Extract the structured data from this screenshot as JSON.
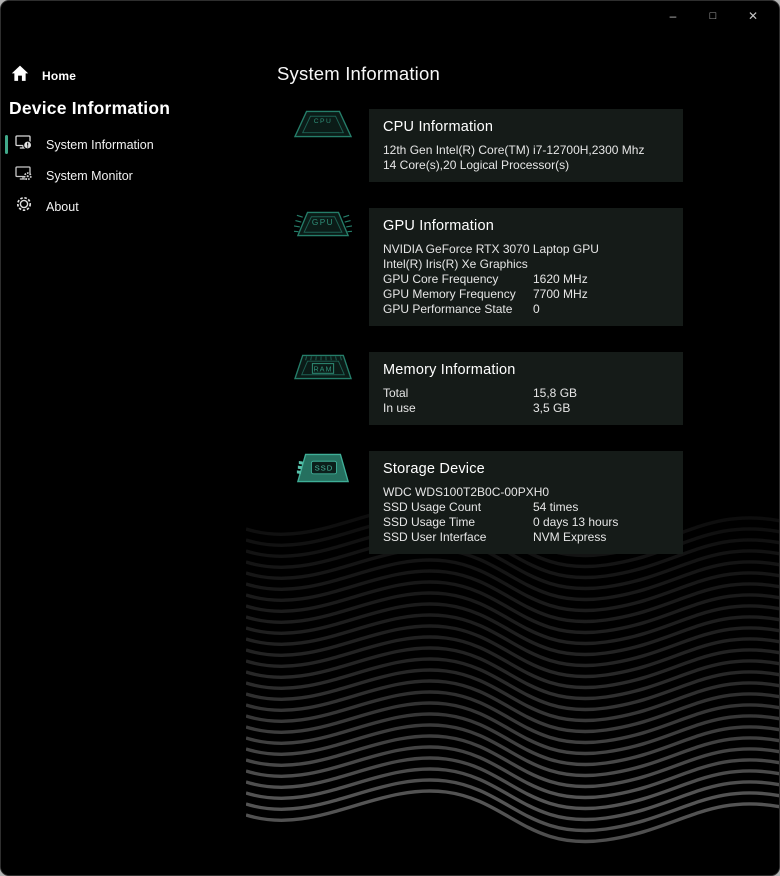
{
  "colors": {
    "accent": "#41a98a",
    "chip_teal": "#2a8770",
    "card_bg": "#151b18"
  },
  "window": {
    "controls": {
      "minimize": "–",
      "maximize": "□",
      "close": "✕"
    }
  },
  "sidebar": {
    "home_label": "Home",
    "heading": "Device Information",
    "items": [
      {
        "label": "System Information",
        "icon": "monitor-info-icon",
        "selected": true
      },
      {
        "label": "System Monitor",
        "icon": "monitor-gear-icon",
        "selected": false
      },
      {
        "label": "About",
        "icon": "gear-icon",
        "selected": false
      }
    ]
  },
  "main": {
    "title": "System Information",
    "cards": [
      {
        "icon": "cpu-chip-icon",
        "icon_label": "CPU",
        "title": "CPU Information",
        "lines": [
          "12th Gen Intel(R) Core(TM) i7-12700H,2300 Mhz",
          "14 Core(s),20 Logical Processor(s)"
        ]
      },
      {
        "icon": "gpu-chip-icon",
        "icon_label": "GPU",
        "title": "GPU Information",
        "lines": [
          "NVIDIA GeForce RTX 3070 Laptop GPU",
          "Intel(R) Iris(R) Xe Graphics"
        ],
        "rows": [
          {
            "label": "GPU Core Frequency",
            "value": "1620 MHz"
          },
          {
            "label": "GPU Memory Frequency",
            "value": "7700 MHz"
          },
          {
            "label": "GPU Performance State",
            "value": "0"
          }
        ]
      },
      {
        "icon": "ram-chip-icon",
        "icon_label": "RAM",
        "title": "Memory Information",
        "rows": [
          {
            "label": "Total",
            "value": "15,8 GB"
          },
          {
            "label": "In use",
            "value": "3,5 GB"
          }
        ]
      },
      {
        "icon": "ssd-chip-icon",
        "icon_label": "SSD",
        "title": "Storage Device",
        "lines": [
          "WDC WDS100T2B0C-00PXH0"
        ],
        "rows": [
          {
            "label": "SSD Usage Count",
            "value": "54 times"
          },
          {
            "label": "SSD Usage Time",
            "value": "0 days 13 hours"
          },
          {
            "label": "SSD User Interface",
            "value": "NVM Express"
          }
        ]
      }
    ]
  }
}
